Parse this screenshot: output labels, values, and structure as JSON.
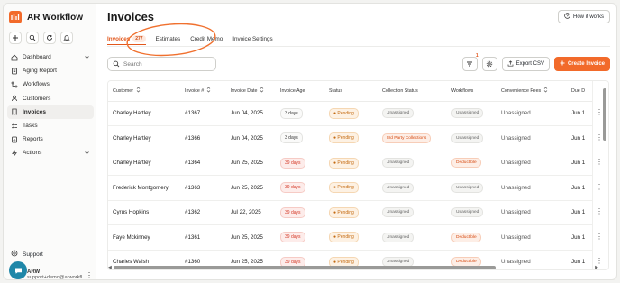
{
  "brand": {
    "name": "AR Workflow",
    "accent": "#f26a2a"
  },
  "sidebar": {
    "items": [
      {
        "label": "Dashboard",
        "icon": "dashboard-icon",
        "has_chevron": true
      },
      {
        "label": "Aging Report",
        "icon": "aging-report-icon"
      },
      {
        "label": "Workflows",
        "icon": "workflows-icon"
      },
      {
        "label": "Customers",
        "icon": "customers-icon"
      },
      {
        "label": "Invoices",
        "icon": "invoices-icon",
        "active": true
      },
      {
        "label": "Tasks",
        "icon": "tasks-icon"
      },
      {
        "label": "Reports",
        "icon": "reports-icon"
      },
      {
        "label": "Actions",
        "icon": "actions-icon",
        "has_chevron": true
      }
    ],
    "support_label": "Support",
    "user_initials": "ARW",
    "user_email": "support+demo@arworkfl..."
  },
  "header": {
    "title": "Invoices",
    "how_it_works": "How it works"
  },
  "tabs": [
    {
      "label": "Invoices",
      "count": "277",
      "active": true
    },
    {
      "label": "Estimates"
    },
    {
      "label": "Credit Memo"
    },
    {
      "label": "Invoice Settings"
    }
  ],
  "toolbar": {
    "search_placeholder": "Search",
    "filter_badge": "1",
    "export_label": "Export CSV",
    "create_label": "Create Invoice"
  },
  "table": {
    "columns": [
      "Customer",
      "Invoice #",
      "Invoice Date",
      "Invoice Age",
      "Status",
      "Collection Status",
      "Workflows",
      "Convenience Fees",
      "Due D"
    ],
    "rows": [
      {
        "customer": "Charley Hartley",
        "invoice": "#1367",
        "date": "Jun 04, 2025",
        "age": "3 days",
        "age_late": false,
        "status": "Pending",
        "collection": "Unassigned",
        "collection_style": "gray",
        "workflow": "Unassigned",
        "workflow_style": "gray",
        "fees": "Unassigned",
        "due": "Jun 1"
      },
      {
        "customer": "Charley Hartley",
        "invoice": "#1366",
        "date": "Jun 04, 2025",
        "age": "3 days",
        "age_late": false,
        "status": "Pending",
        "collection": "3rd Party Collections",
        "collection_style": "orange",
        "workflow": "Unassigned",
        "workflow_style": "gray",
        "fees": "Unassigned",
        "due": "Jun 1"
      },
      {
        "customer": "Charley Hartley",
        "invoice": "#1364",
        "date": "Jun 25, 2025",
        "age": "39 days",
        "age_late": true,
        "status": "Pending",
        "collection": "Unassigned",
        "collection_style": "gray",
        "workflow": "Deductible",
        "workflow_style": "orange",
        "fees": "Unassigned",
        "due": "Jun 1"
      },
      {
        "customer": "Frederick Montgomery",
        "invoice": "#1363",
        "date": "Jun 25, 2025",
        "age": "39 days",
        "age_late": true,
        "status": "Pending",
        "collection": "Unassigned",
        "collection_style": "gray",
        "workflow": "Unassigned",
        "workflow_style": "gray",
        "fees": "Unassigned",
        "due": "Jun 1"
      },
      {
        "customer": "Cyrus Hopkins",
        "invoice": "#1362",
        "date": "Jul 22, 2025",
        "age": "39 days",
        "age_late": true,
        "status": "Pending",
        "collection": "Unassigned",
        "collection_style": "gray",
        "workflow": "Unassigned",
        "workflow_style": "gray",
        "fees": "Unassigned",
        "due": "Jun 1"
      },
      {
        "customer": "Faye Mckinney",
        "invoice": "#1361",
        "date": "Jun 25, 2025",
        "age": "39 days",
        "age_late": true,
        "status": "Pending",
        "collection": "Unassigned",
        "collection_style": "gray",
        "workflow": "Deductible",
        "workflow_style": "orange",
        "fees": "Unassigned",
        "due": "Jun 1"
      },
      {
        "customer": "Charles Walsh",
        "invoice": "#1360",
        "date": "Jun 25, 2025",
        "age": "39 days",
        "age_late": true,
        "status": "Pending",
        "collection": "Unassigned",
        "collection_style": "gray",
        "workflow": "Deductible",
        "workflow_style": "orange",
        "fees": "Unassigned",
        "due": "Jun 1"
      }
    ]
  }
}
